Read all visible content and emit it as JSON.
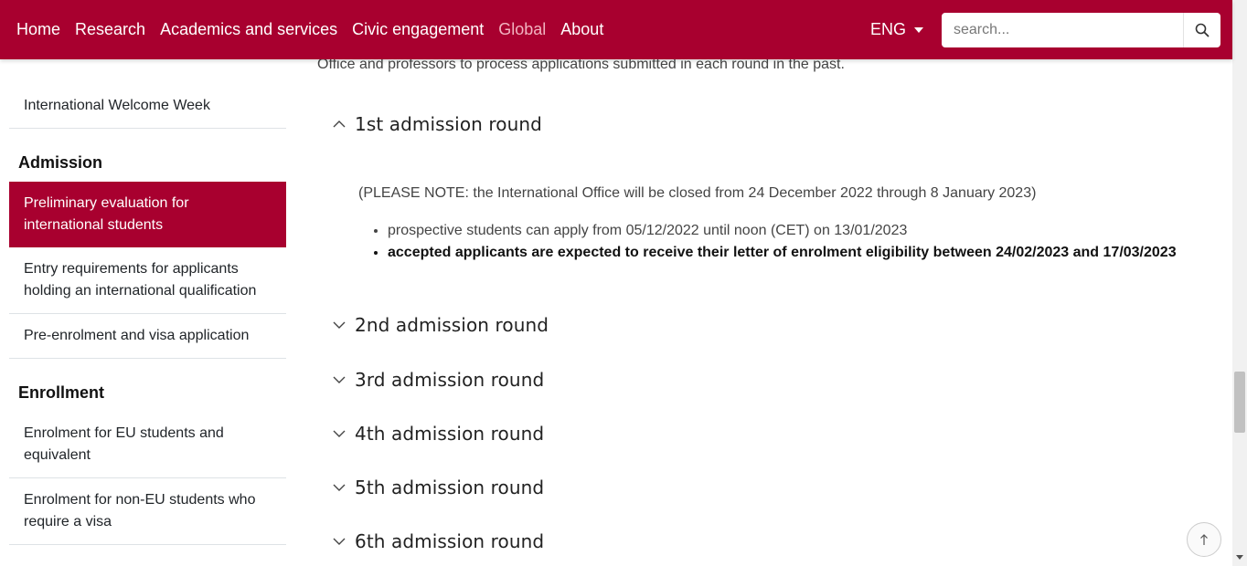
{
  "nav": {
    "items": [
      {
        "label": "Home"
      },
      {
        "label": "Research"
      },
      {
        "label": "Academics and services"
      },
      {
        "label": "Civic engagement"
      },
      {
        "label": "Global",
        "active": true
      },
      {
        "label": "About"
      }
    ],
    "language": "ENG",
    "search_placeholder": "search...",
    "search_icon": "search-icon",
    "brand_color": "#a8002f"
  },
  "sidebar": {
    "item_welcome": "International Welcome Week",
    "heading_admission": "Admission",
    "item_preliminary": "Preliminary evaluation for international students",
    "item_entry": "Entry requirements for applicants holding an international qualification",
    "item_preenrolment": "Pre-enrolment and visa application",
    "heading_enrollment": "Enrollment",
    "item_eu": "Enrolment for EU students and equivalent",
    "item_noneu": "Enrolment for non-EU students who require a visa"
  },
  "main": {
    "intro_text": "Office and professors to process applications submitted in each round in the past.",
    "rounds": [
      {
        "title": "1st admission round",
        "expanded": true
      },
      {
        "title": "2nd admission round",
        "expanded": false
      },
      {
        "title": "3rd admission round",
        "expanded": false
      },
      {
        "title": "4th admission round",
        "expanded": false
      },
      {
        "title": "5th admission round",
        "expanded": false
      },
      {
        "title": "6th admission round",
        "expanded": false
      }
    ],
    "round1": {
      "note": "(PLEASE NOTE: the International Office will be closed from 24 December 2022 through 8 January 2023)",
      "bullets": [
        "prospective students can apply from 05/12/2022 until noon (CET) on 13/01/2023",
        "accepted applicants are expected to receive their letter of enrolment eligibility between 24/02/2023 and 17/03/2023"
      ]
    }
  },
  "back_to_top_icon": "arrow-up-icon"
}
